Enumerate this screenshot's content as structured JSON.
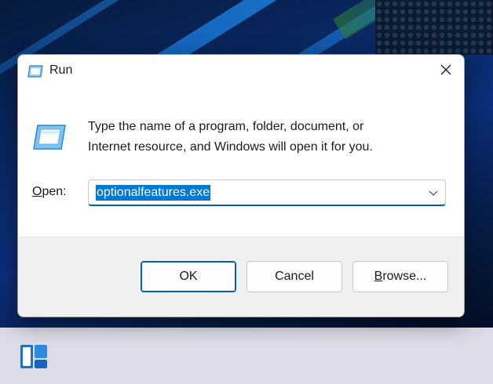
{
  "dialog": {
    "title": "Run",
    "icon": "run-icon",
    "close_icon": "close-icon",
    "description_line1": "Type the name of a program, folder, document, or",
    "description_line2": "Internet resource, and Windows will open it for you.",
    "open_label_mnemonic": "O",
    "open_label_rest": "pen:",
    "input_value": "optionalfeatures.exe",
    "buttons": {
      "ok": "OK",
      "cancel": "Cancel",
      "browse_mnemonic": "B",
      "browse_rest": "rowse..."
    }
  },
  "taskbar": {
    "widgets_icon": "widgets-icon"
  },
  "colors": {
    "accent": "#0078d4",
    "accent_border": "#005fb8",
    "taskbar": "#dcdce8",
    "footer": "#f0f0f0"
  }
}
